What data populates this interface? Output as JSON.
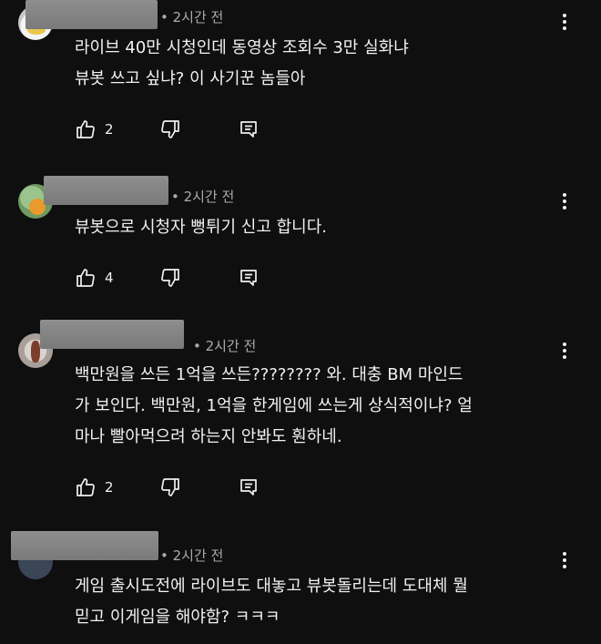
{
  "comments": [
    {
      "time": "• 2시간 전",
      "text_lines": [
        "라이브 40만 시청인데 동영상 조회수 3만 실화냐",
        "뷰봇 쓰고 싶냐? 이 사기꾼 놈들아"
      ],
      "like_count": "2"
    },
    {
      "time": "• 2시간 전",
      "text_lines": [
        "뷰봇으로 시청자 뻥튀기 신고 합니다."
      ],
      "like_count": "4"
    },
    {
      "time": "• 2시간 전",
      "text_lines": [
        "백만원을 쓰든 1억을 쓰든???????? 와. 대충 BM 마인드",
        "가 보인다. 백만원, 1억을 한게임에 쓰는게 상식적이냐? 얼",
        "마나 빨아먹으려 하는지 안봐도 훤하네."
      ],
      "like_count": "2"
    },
    {
      "time": "• 2시간 전",
      "text_lines": [
        "게임 출시도전에 라이브도 대놓고 뷰봇돌리는데 도대체 뭘",
        "믿고 이게임을 해야함? ㅋㅋㅋ"
      ],
      "like_count": ""
    }
  ],
  "icons": {
    "like": "thumb-up-icon",
    "dislike": "thumb-down-icon",
    "reply": "reply-comment-icon",
    "more": "more-vert-icon"
  },
  "colors": {
    "background": "#0f0f0f",
    "text": "#f1f1f1",
    "meta": "#aaaaaa",
    "redaction": "#8a8a8a"
  }
}
